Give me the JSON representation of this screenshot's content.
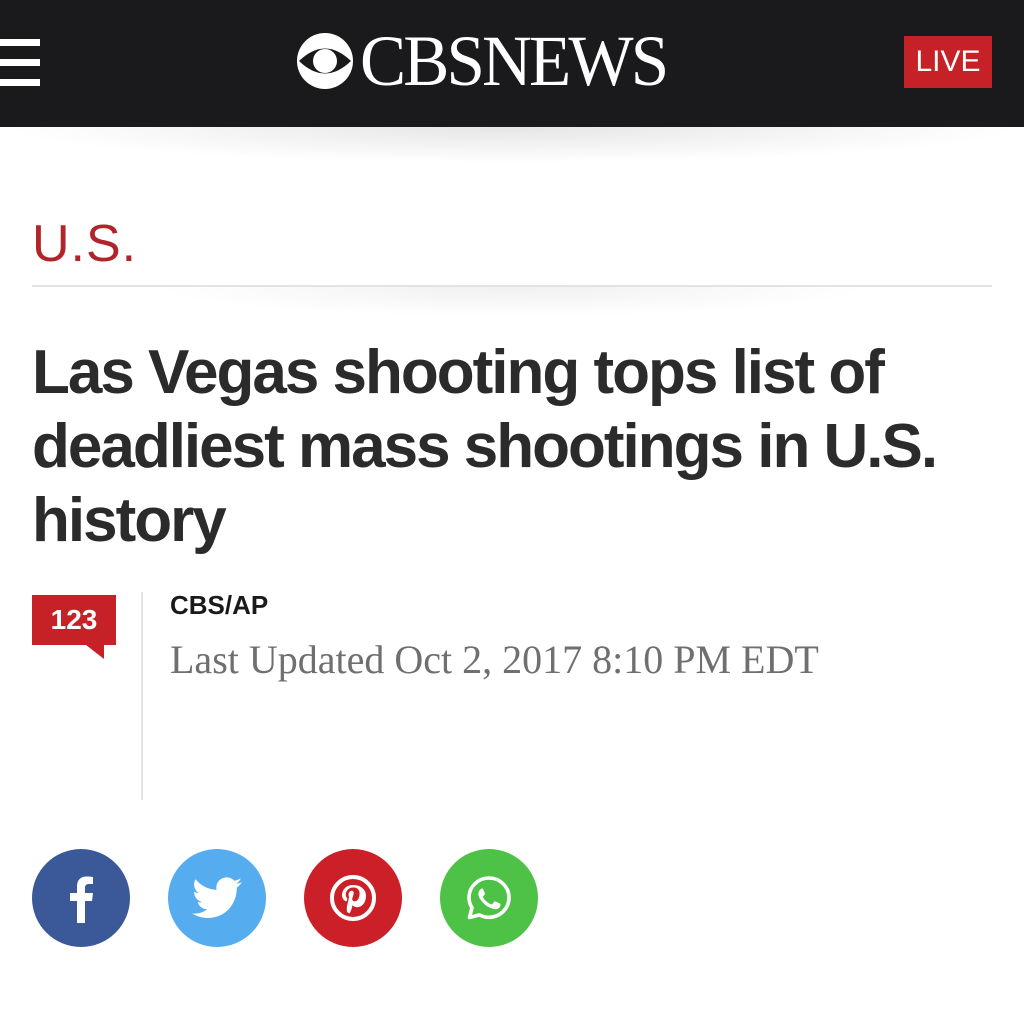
{
  "header": {
    "logo_text": "CBSNEWS",
    "live_label": "LIVE",
    "background_color": "#1a1a1c",
    "live_color": "#c62126"
  },
  "article": {
    "section": "U.S.",
    "headline": "Las Vegas shooting tops list of deadliest mass shootings in U.S. history",
    "comment_count": "123",
    "byline": "CBS/AP",
    "updated": "Last Updated Oct 2, 2017 8:10 PM EDT",
    "section_color": "#b1242b"
  },
  "share": {
    "buttons": [
      {
        "name": "facebook",
        "icon": "facebook-icon",
        "color": "#3b5998"
      },
      {
        "name": "twitter",
        "icon": "twitter-icon",
        "color": "#55acee"
      },
      {
        "name": "pinterest",
        "icon": "pinterest-icon",
        "color": "#cb2027"
      },
      {
        "name": "whatsapp",
        "icon": "whatsapp-icon",
        "color": "#4dc247"
      }
    ]
  }
}
